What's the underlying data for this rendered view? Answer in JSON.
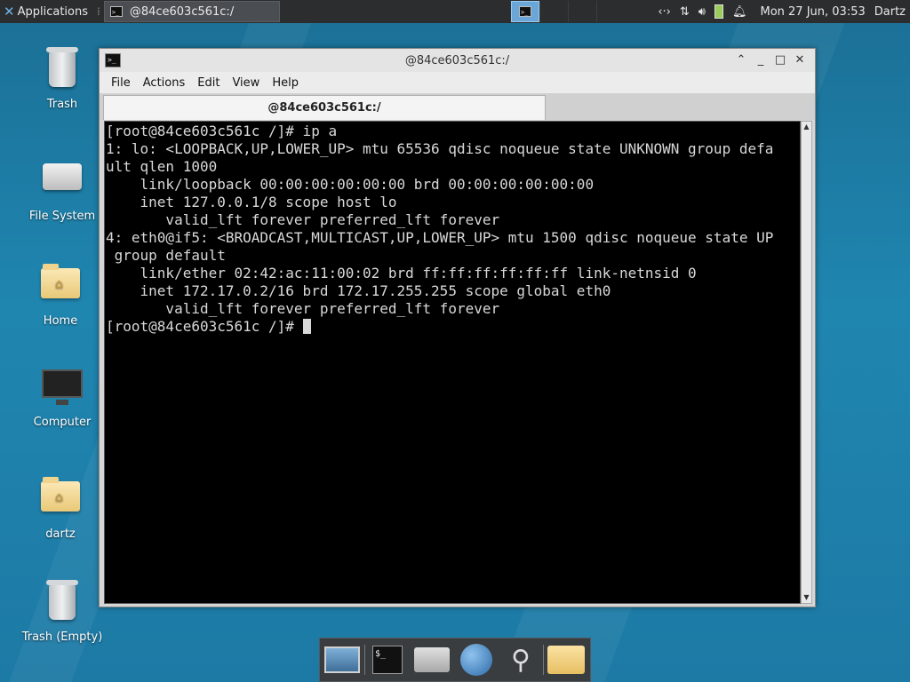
{
  "top_panel": {
    "applications_label": "Applications",
    "task_title": "@84ce603c561c:/",
    "clock": "Mon 27 Jun, 03:53",
    "user": "Dartz"
  },
  "desktop_icons": [
    {
      "label": "Trash"
    },
    {
      "label": "File System"
    },
    {
      "label": "Home"
    },
    {
      "label": "Computer"
    },
    {
      "label": "dartz"
    },
    {
      "label": "Trash (Empty)"
    }
  ],
  "window": {
    "title": "@84ce603c561c:/",
    "menu": [
      "File",
      "Actions",
      "Edit",
      "View",
      "Help"
    ],
    "tab_label": "@84ce603c561c:/",
    "terminal_lines": [
      "[root@84ce603c561c /]# ip a",
      "1: lo: <LOOPBACK,UP,LOWER_UP> mtu 65536 qdisc noqueue state UNKNOWN group defa",
      "ult qlen 1000",
      "    link/loopback 00:00:00:00:00:00 brd 00:00:00:00:00:00",
      "    inet 127.0.0.1/8 scope host lo",
      "       valid_lft forever preferred_lft forever",
      "4: eth0@if5: <BROADCAST,MULTICAST,UP,LOWER_UP> mtu 1500 qdisc noqueue state UP",
      " group default",
      "    link/ether 02:42:ac:11:00:02 brd ff:ff:ff:ff:ff:ff link-netnsid 0",
      "    inet 172.17.0.2/16 brd 172.17.255.255 scope global eth0",
      "       valid_lft forever preferred_lft forever"
    ],
    "prompt": "[root@84ce603c561c /]# "
  },
  "dock": {
    "items": [
      "desktop-icon",
      "terminal-icon",
      "home-folder-icon",
      "web-browser-icon",
      "search-icon",
      "folder-icon"
    ]
  }
}
